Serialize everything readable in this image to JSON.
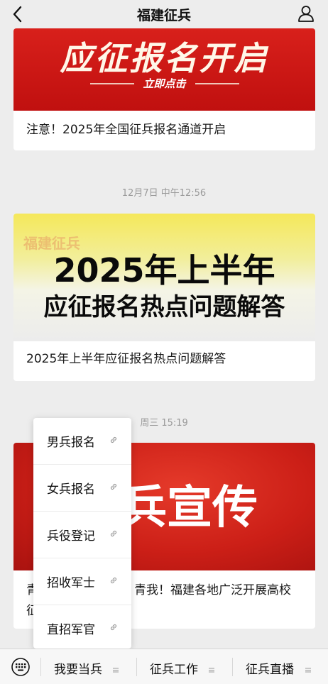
{
  "header": {
    "title": "福建征兵"
  },
  "cards": [
    {
      "banner_text": "应征报名开启",
      "banner_sub": "立即点击",
      "caption": "注意！2025年全国征兵报名通道开启"
    },
    {
      "timestamp": "12月7日 中午12:56",
      "banner_watermark": "福建征兵",
      "banner_line1": "2025年上半年",
      "banner_line2": "应征报名热点问题解答",
      "caption": "2025年上半年应征报名热点问题解答"
    },
    {
      "timestamp": "周三 15:19",
      "banner_text": "兵宣传",
      "caption_line1_start": "青",
      "caption_line1_end": "青我！福建各地广泛开展高校",
      "caption_line2_start": "征"
    }
  ],
  "popup_menu": {
    "items": [
      {
        "label": "男兵报名",
        "icon": "link-icon"
      },
      {
        "label": "女兵报名",
        "icon": "link-icon"
      },
      {
        "label": "兵役登记",
        "icon": "link-icon"
      },
      {
        "label": "招收军士",
        "icon": "link-icon"
      },
      {
        "label": "直招军官",
        "icon": "link-icon"
      }
    ]
  },
  "bottom_bar": {
    "tabs": [
      {
        "label": "我要当兵"
      },
      {
        "label": "征兵工作"
      },
      {
        "label": "征兵直播"
      }
    ]
  },
  "colors": {
    "background": "#ededed",
    "banner_red": "#c0100f",
    "text": "#111111",
    "timestamp": "#9a9a9a"
  }
}
